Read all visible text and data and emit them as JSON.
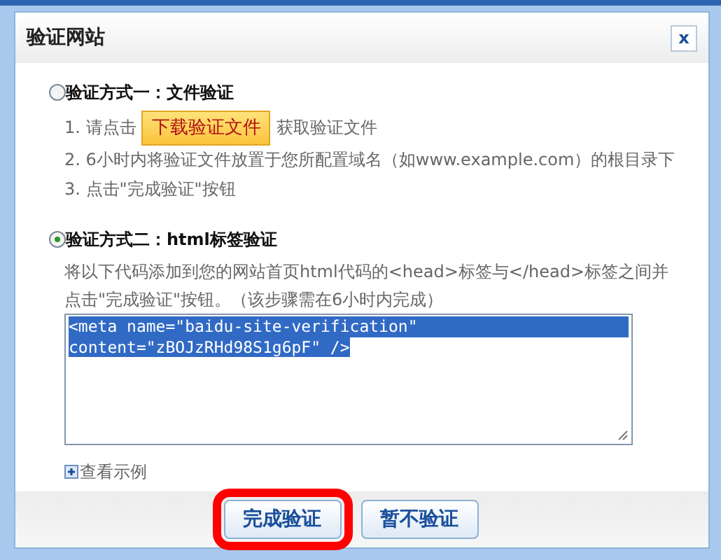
{
  "dialog": {
    "title": "验证网站",
    "close": "x"
  },
  "methods": [
    {
      "label": "验证方式一：文件验证",
      "selected": false,
      "steps": [
        {
          "kind": "button_step",
          "before": "1. 请点击",
          "button": "下载验证文件",
          "after": "获取验证文件"
        },
        {
          "kind": "text",
          "text": "2. 6小时内将验证文件放置于您所配置域名（如www.example.com）的根目录下"
        },
        {
          "kind": "text",
          "text": "3. 点击\"完成验证\"按钮"
        }
      ]
    },
    {
      "label": "验证方式二：html标签验证",
      "selected": true,
      "description": "将以下代码添加到您的网站首页html代码的<head>标签与</head>标签之间并点击\"完成验证\"按钮。（该步骤需在6小时内完成）",
      "code": [
        "<meta name=\"baidu-site-verification\"",
        "content=\"zBOJzRHd98S1g6pF\" />"
      ],
      "code_selected": true,
      "example_link": "查看示例"
    }
  ],
  "buttons": [
    {
      "label": "完成验证",
      "highlighted": true
    },
    {
      "label": "暂不验证",
      "highlighted": false
    }
  ]
}
